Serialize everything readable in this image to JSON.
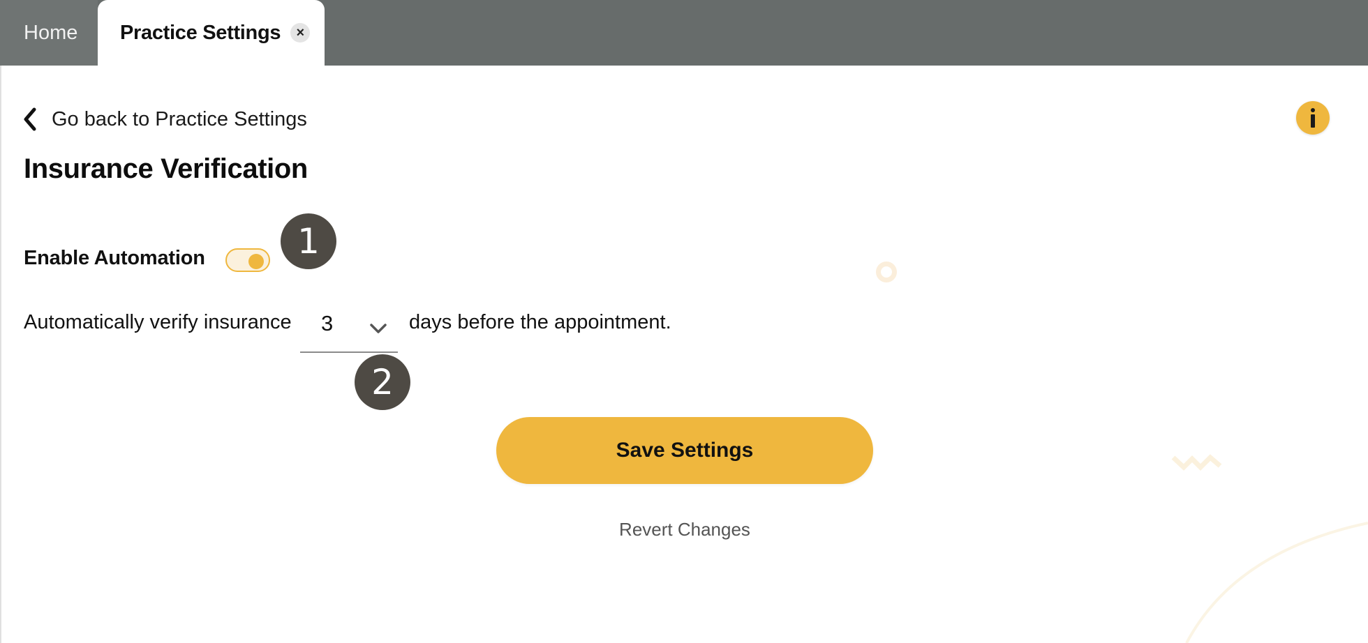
{
  "tabs": {
    "home_label": "Home",
    "active_label": "Practice Settings",
    "close_glyph": "×"
  },
  "back_link": {
    "label": "Go back to Practice Settings",
    "icon": "chevron-left-icon"
  },
  "info_button": {
    "icon": "info-icon"
  },
  "page_title": "Insurance Verification",
  "automation": {
    "label": "Enable Automation",
    "enabled": true
  },
  "verify": {
    "prefix": "Automatically verify insurance",
    "days_value": "3",
    "suffix": "days before the appointment."
  },
  "badges": {
    "one": "1",
    "two": "2"
  },
  "actions": {
    "save_label": "Save Settings",
    "revert_label": "Revert Changes"
  },
  "colors": {
    "accent": "#efb73e",
    "tabbar": "#676c6b",
    "badge": "#4e4a44"
  }
}
